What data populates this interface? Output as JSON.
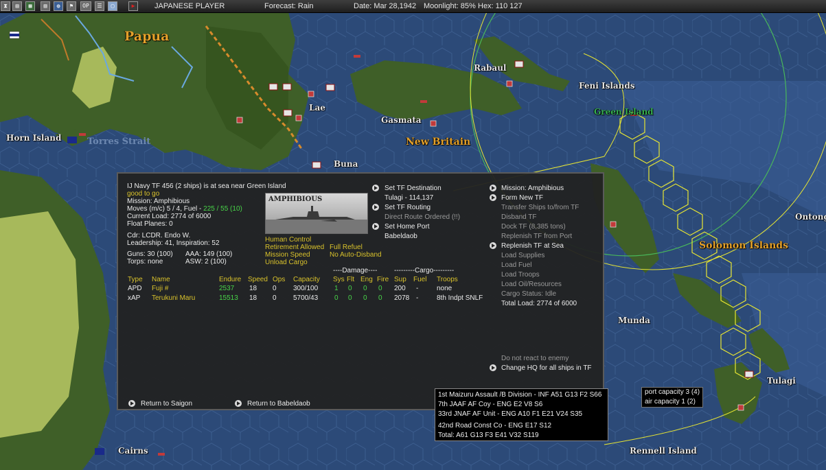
{
  "topbar": {
    "player": "JAPANESE PLAYER",
    "forecast": "Forecast: Rain",
    "date": "Date: Mar 28,1942",
    "moonlight": "Moonlight: 85%",
    "hex": "Hex: 110 127",
    "icons": [
      "hourglass-icon",
      "save-icon",
      "map-icon",
      "chart-icon",
      "globe-icon",
      "flag-icon",
      "ops-icon",
      "list-icon",
      "window-icon",
      "play-icon"
    ],
    "op_label": "OP"
  },
  "map_labels": {
    "papua": "Papua",
    "rabaul": "Rabaul",
    "feni_islands": "Feni Islands",
    "green_island": "Green Island",
    "lae": "Lae",
    "gasmata": "Gasmata",
    "new_britain": "New Britain",
    "horn_island": "Horn Island",
    "torres_strait": "Torres Strait",
    "buna": "Buna",
    "ontong": "Ontong",
    "solomon_islands": "Solomon Islands",
    "munda": "Munda",
    "tulagi": "Tulagi",
    "cairns": "Cairns",
    "rennell_island": "Rennell Island"
  },
  "panel": {
    "tf_header": "IJ Navy TF 456 (2 ships) is at sea near Green Island",
    "status": "good to go",
    "mission": "Mission: Amphibious",
    "moves_prefix": "Moves (m/c) 5 / 4, Fuel -",
    "fuel_value": "225 / 55 (10)",
    "current_load": "Current Load: 2774 of 6000",
    "float_planes": "Float Planes: 0",
    "cdr": "Cdr: LCDR. Endo W.",
    "leadership": "Leadership: 41, Inspiration: 52",
    "guns": "Guns: 30 (100)",
    "aaa": "AAA: 149 (100)",
    "torps": "Torps: none",
    "asw": "ASW: 2 (100)",
    "photo_title": "AMPHIBIOUS",
    "human_control": "Human Control",
    "retirement": "Retirement Allowed",
    "full_refuel": "Full Refuel",
    "mission_speed": "Mission Speed",
    "no_auto_disband": "No Auto-Disband",
    "unload_cargo": "Unload Cargo",
    "center_menu": {
      "set_destination": "Set TF Destination",
      "destination_value": "Tulagi - 114,137",
      "set_routing": "Set TF Routing",
      "direct_route": "Direct Route Ordered (!!)",
      "set_home_port": "Set Home Port",
      "home_port_value": "Babeldaob"
    },
    "right_menu": {
      "mission": "Mission: Amphibious",
      "form_new_tf": "Form New TF",
      "transfer_ships": "Transfer Ships to/from TF",
      "disband_tf": "Disband TF",
      "dock_tf": "Dock TF (8,385 tons)",
      "replenish_port": "Replenish TF from Port",
      "replenish_sea": "Replenish TF at Sea",
      "load_supplies": "Load Supplies",
      "load_fuel": "Load Fuel",
      "load_troops": "Load Troops",
      "load_oil": "Load Oil/Resources",
      "cargo_status": "Cargo Status: Idle",
      "total_load": "Total Load: 2774 of 6000",
      "no_react": "Do not react to enemy",
      "change_hq": "Change HQ for all ships in TF"
    },
    "table": {
      "damage_header": "----Damage----",
      "cargo_header": "---------Cargo---------",
      "columns": [
        "Type",
        "Name",
        "Endure",
        "Speed",
        "Ops",
        "Capacity",
        "Sys",
        "Flt",
        "Eng",
        "Fire",
        "Sup",
        "Fuel",
        "Troops"
      ],
      "rows": [
        [
          "APD",
          "Fuji #",
          "2537",
          "18",
          "0",
          "300/100",
          "1",
          "0",
          "0",
          "0",
          "200",
          "-",
          "none"
        ],
        [
          "xAP",
          "Terukuni Maru",
          "15513",
          "18",
          "0",
          "5700/43",
          "0",
          "0",
          "0",
          "0",
          "2078",
          "-",
          "8th Indpt SNLF"
        ]
      ]
    },
    "return_saigon": "Return to Saigon",
    "return_babeldaob": "Return to Babeldaob"
  },
  "infobox": {
    "rows": [
      "1st Maizuru Assault /B Division - INF   A51  G13  F2  S66",
      "7th JAAF AF Coy  - ENG   E2  V8  S6",
      "33rd JNAF AF Unit  - ENG   A10  F1  E21  V24  S35",
      "42nd Road Const Co  - ENG   E17  S12",
      "Total:  A61   G13  F3   E41   V32  S119"
    ]
  },
  "portbox": {
    "port": "port capacity 3 (4)",
    "air": "air capacity 1 (2)"
  },
  "colors": {
    "sea": "#2c4a78",
    "land": "#3f5f28",
    "yellow_hex": "#e8e632",
    "range_green": "#49b85a",
    "panel_bg": "#222222",
    "highlight_green": "#48d448",
    "highlight_yellow": "#d9c22b"
  }
}
